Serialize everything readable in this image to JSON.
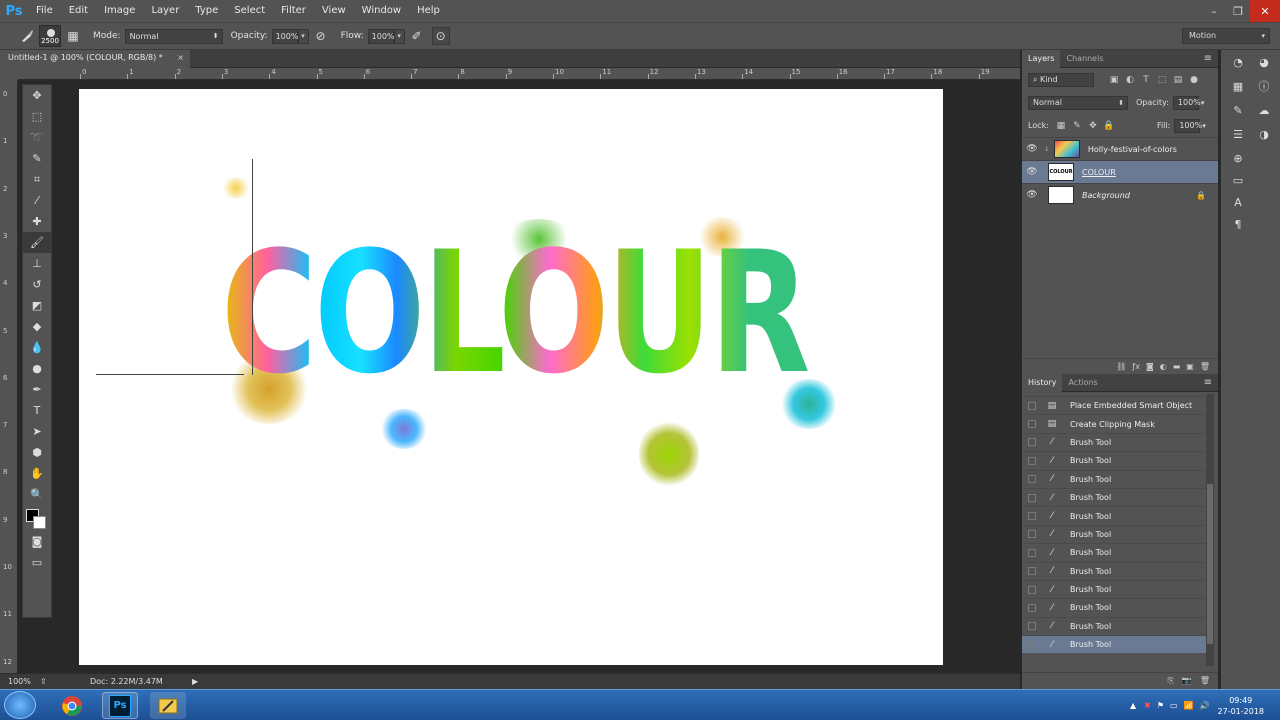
{
  "app": {
    "logo": "Ps",
    "title": "Untitled-1 @ 100% (COLOUR, RGB/8) *"
  },
  "menu": [
    "File",
    "Edit",
    "Image",
    "Layer",
    "Type",
    "Select",
    "Filter",
    "View",
    "Window",
    "Help"
  ],
  "window_controls": {
    "minimize": "–",
    "restore": "❐",
    "close": "✕"
  },
  "options_bar": {
    "brush_size": "2500",
    "mode_label": "Mode:",
    "mode_value": "Normal",
    "opacity_label": "Opacity:",
    "opacity_value": "100%",
    "flow_label": "Flow:",
    "flow_value": "100%",
    "workspace": "Motion"
  },
  "document_tab": {
    "title": "Untitled-1 @ 100% (COLOUR, RGB/8) *",
    "close": "×"
  },
  "ruler_top": [
    "0",
    "1",
    "2",
    "3",
    "4",
    "5",
    "6",
    "7",
    "8",
    "9",
    "10",
    "11",
    "12",
    "13",
    "14",
    "15",
    "16",
    "17",
    "18",
    "19"
  ],
  "ruler_left": [
    "0",
    "1",
    "2",
    "3",
    "4",
    "5",
    "6",
    "7",
    "8",
    "9",
    "10",
    "11",
    "12"
  ],
  "canvas": {
    "art_text": "COLOUR"
  },
  "status": {
    "zoom": "100%",
    "doc": "Doc: 2.22M/3.47M"
  },
  "layers_panel": {
    "tabs": [
      "Layers",
      "Channels"
    ],
    "filter_kind": "Kind",
    "blend_mode": "Normal",
    "opacity_label": "Opacity:",
    "opacity_value": "100%",
    "lock_label": "Lock:",
    "fill_label": "Fill:",
    "fill_value": "100%",
    "layers": [
      {
        "name": "Holly-festival-of-colors",
        "visible": true,
        "selected": false
      },
      {
        "name": "COLOUR",
        "visible": true,
        "selected": true
      },
      {
        "name": "Background",
        "visible": true,
        "selected": false,
        "locked": true
      }
    ]
  },
  "history_panel": {
    "tabs": [
      "History",
      "Actions"
    ],
    "items": [
      "Place Embedded Smart Object",
      "Create Clipping Mask",
      "Brush Tool",
      "Brush Tool",
      "Brush Tool",
      "Brush Tool",
      "Brush Tool",
      "Brush Tool",
      "Brush Tool",
      "Brush Tool",
      "Brush Tool",
      "Brush Tool",
      "Brush Tool",
      "Brush Tool"
    ],
    "selected_index": 13
  },
  "taskbar": {
    "time": "09:49",
    "date": "27-01-2018"
  },
  "colors": {
    "accent": "#31a8ff",
    "selection": "#6b7a93",
    "panel": "#535353",
    "canvas_bg": "#282828"
  }
}
